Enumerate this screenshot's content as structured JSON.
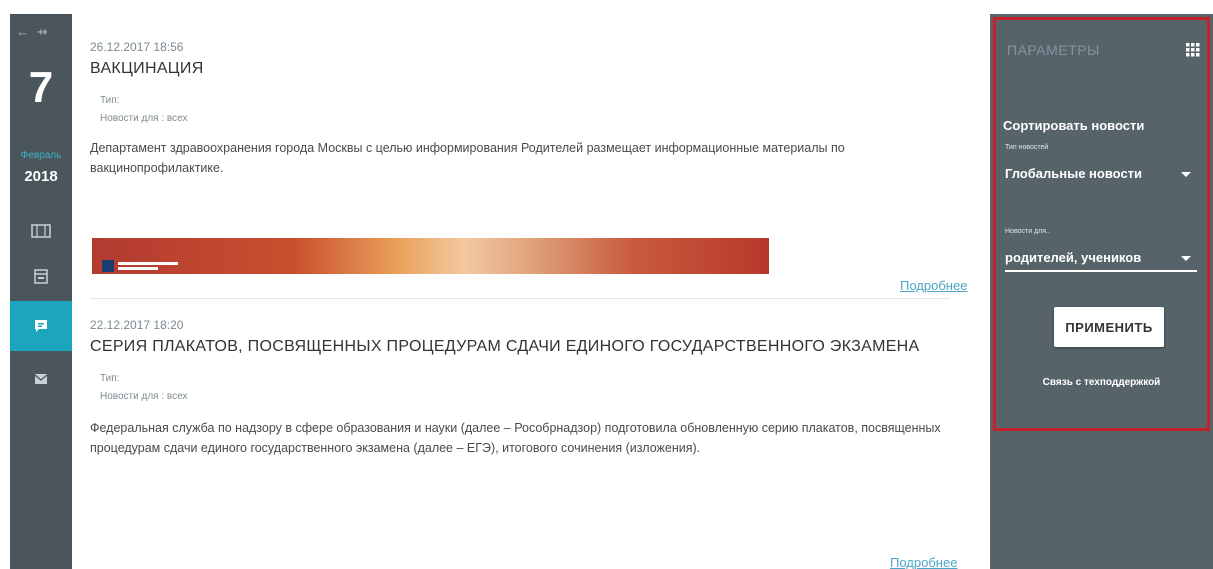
{
  "rail": {
    "arrows": "← ⇸",
    "day": "7",
    "month": "Февраль",
    "year": "2018",
    "items": [
      {
        "icon": "calendar-week-icon",
        "active": false
      },
      {
        "icon": "calendar-day-icon",
        "active": false
      },
      {
        "icon": "news-icon",
        "active": true
      },
      {
        "icon": "mail-icon",
        "active": false
      }
    ]
  },
  "news": [
    {
      "date": "26.12.2017 18:56",
      "title": "ВАКЦИНАЦИЯ",
      "type_label": "Тип:",
      "audience_label": "Новости для :",
      "audience_value": "всех",
      "body": "Департамент здравоохранения города Москвы с целью информирования Родителей размещает информационные материалы по вакцинопрофилактике.",
      "more": "Подробнее"
    },
    {
      "date": "22.12.2017 18:20",
      "title": "СЕРИЯ ПЛАКАТОВ, ПОСВЯЩЕННЫХ ПРОЦЕДУРАМ СДАЧИ ЕДИНОГО ГОСУДАРСТВЕННОГО ЭКЗАМЕНА",
      "type_label": "Тип:",
      "audience_label": "Новости для :",
      "audience_value": "всех",
      "body": "Федеральная служба по надзору в сфере образования и науки (далее – Рособрнадзор) подготовила обновленную серию плакатов, посвященных процедурам сдачи единого государственного экзамена (далее – ЕГЭ), итогового сочинения (изложения).",
      "more": "Подробнее"
    }
  ],
  "panel": {
    "title": "ПАРАМЕТРЫ",
    "sort_label": "Сортировать новости",
    "type_small": "Тип новостей",
    "type_value": "Глобальные новости",
    "for_small": "Новости для..",
    "for_value": "родителей, учеников",
    "apply": "ПРИМЕНИТЬ",
    "support": "Связь с техподдержкой"
  },
  "colors": {
    "rail": "#4a565c",
    "accent": "#1ba6be",
    "panel": "#56646a",
    "highlight": "#c4222a",
    "link": "#4aa6c8"
  }
}
